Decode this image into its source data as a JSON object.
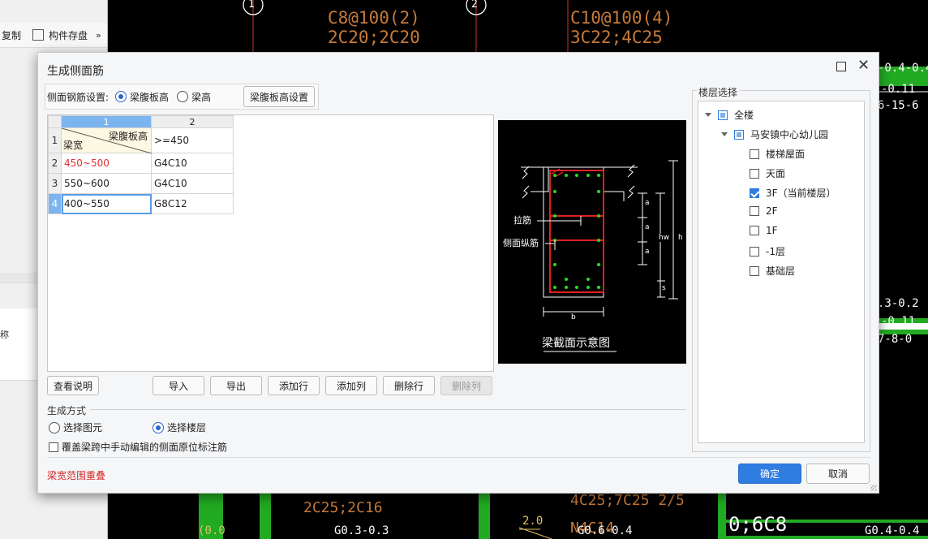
{
  "background": {
    "left_toolbar": {
      "copy_label": "复制",
      "store_label": "构件存盘",
      "more": "»"
    },
    "left_partial_labels": [
      "称"
    ],
    "cad_labels": [
      {
        "text": "1",
        "color": "#ffffff"
      },
      {
        "text": "2",
        "color": "#ffffff"
      },
      {
        "text": "C8@100(2)",
        "color": "#c77a3a"
      },
      {
        "text": "2C20;2C20",
        "color": "#c77a3a"
      },
      {
        "text": "C10@100(4)",
        "color": "#c77a3a"
      },
      {
        "text": "3C22;4C25",
        "color": "#c77a3a"
      },
      {
        "text": "-0.4-0.4",
        "color": "#ffffff"
      },
      {
        "text": "-0.11",
        "color": "#ffffff"
      },
      {
        "text": "6-15-6",
        "color": "#ffffff"
      },
      {
        "text": ".3-0.2",
        "color": "#ffffff"
      },
      {
        "text": "-0.11",
        "color": "#ffffff"
      },
      {
        "text": "7-8-0",
        "color": "#ffffff"
      },
      {
        "text": "2C25;2C16",
        "color": "#c77a3a"
      },
      {
        "text": "4C25;7C25 2/5",
        "color": "#c77a3a"
      },
      {
        "text": "N4C14",
        "color": "#c77a3a"
      },
      {
        "text": "0;6C8",
        "color": "#ffffff"
      },
      {
        "text": "G0.3-0.3",
        "color": "#ffffff"
      },
      {
        "text": "G0.6-0.4",
        "color": "#ffffff"
      },
      {
        "text": "G0.4-0.4",
        "color": "#ffffff"
      },
      {
        "text": "2.0",
        "color": "#e0c060"
      },
      {
        "text": "(0.0",
        "color": "#e0c060"
      }
    ]
  },
  "dialog": {
    "title": "生成侧面筋",
    "maximize_icon": "maximize-icon",
    "close_icon": "close-icon",
    "close_glyph": "✕",
    "setting": {
      "label": "侧面钢筋设置:",
      "option1": "梁腹板高",
      "option2": "梁高",
      "selected": "梁腹板高",
      "config_button": "梁腹板高设置"
    },
    "grid": {
      "col_headers": [
        "1",
        "2"
      ],
      "corner_top": "梁腹板高",
      "corner_bottom": "梁宽",
      "header_value": ">=450",
      "rows": [
        {
          "num": "1",
          "c1": "",
          "c2": ""
        },
        {
          "num": "2",
          "c1": "450~500",
          "c2": "G4C10",
          "c1_color": "#e03030"
        },
        {
          "num": "3",
          "c1": "550~600",
          "c2": "G4C10"
        },
        {
          "num": "4",
          "c1": "400~550",
          "c2": "G8C12"
        }
      ]
    },
    "diagram": {
      "caption": "梁截面示意图",
      "label_tie": "拉筋",
      "label_side": "侧面纵筋",
      "dim_a": "a",
      "dim_hw": "hw",
      "dim_h": "h",
      "dim_s": "s",
      "dim_b": "b"
    },
    "buttons": {
      "help": "查看说明",
      "import": "导入",
      "export": "导出",
      "add_row": "添加行",
      "add_col": "添加列",
      "del_row": "删除行",
      "del_col": "删除列"
    },
    "generate": {
      "label": "生成方式",
      "opt_element": "选择图元",
      "opt_floor": "选择楼层",
      "selected": "选择楼层",
      "override_label": "覆盖梁跨中手动编辑的侧面原位标注筋",
      "override_checked": false
    },
    "floor_select": {
      "legend": "楼层选择",
      "root": "全楼",
      "project": "马安镇中心幼儿园",
      "floors": [
        {
          "name": "楼梯屋面",
          "checked": false
        },
        {
          "name": "天面",
          "checked": false
        },
        {
          "name": "3F（当前楼层）",
          "checked": true
        },
        {
          "name": "2F",
          "checked": false
        },
        {
          "name": "1F",
          "checked": false
        },
        {
          "name": "-1层",
          "checked": false
        },
        {
          "name": "基础层",
          "checked": false
        }
      ]
    },
    "footer": {
      "warning": "梁宽范围重叠",
      "ok": "确定",
      "cancel": "取消"
    }
  }
}
